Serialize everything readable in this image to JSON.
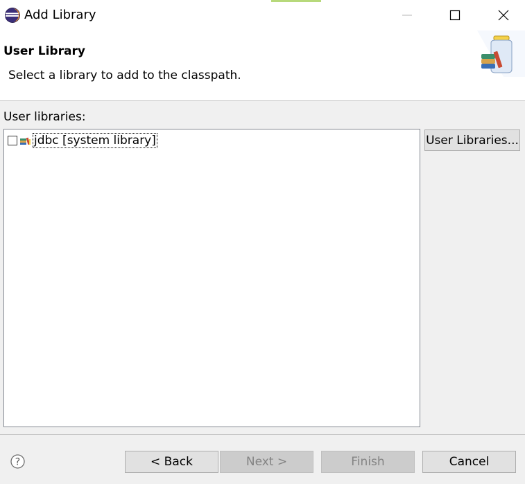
{
  "window": {
    "title": "Add Library",
    "accent_color": "#b7d97b"
  },
  "header": {
    "title": "User Library",
    "description": "Select a library to add to the classpath.",
    "icon": "library-jar-icon"
  },
  "content": {
    "section_label": "User libraries:",
    "libraries": [
      {
        "label": "jdbc [system library]",
        "checked": false,
        "icon": "library-icon"
      }
    ],
    "user_libraries_button": "User Libraries..."
  },
  "footer": {
    "help_icon": "help-icon",
    "back_label": "< Back",
    "next_label": "Next >",
    "finish_label": "Finish",
    "cancel_label": "Cancel",
    "next_enabled": false,
    "finish_enabled": false
  }
}
